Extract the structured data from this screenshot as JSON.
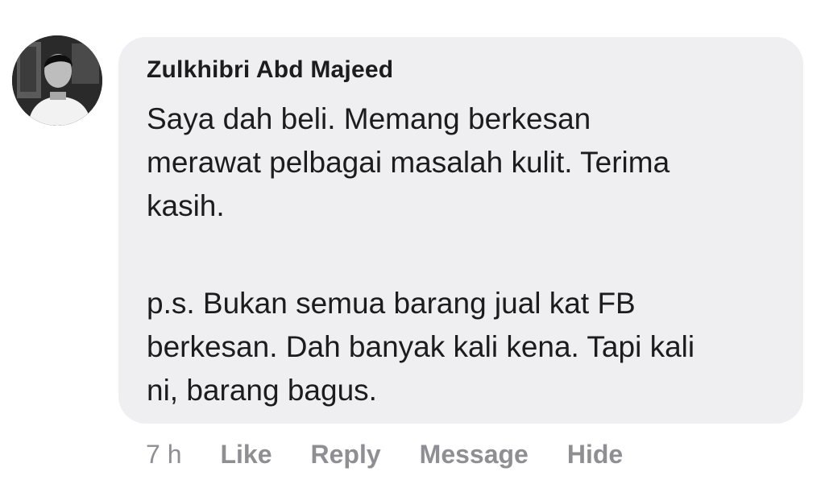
{
  "comment": {
    "author": "Zulkhibri Abd Majeed",
    "paragraph1": "Saya dah beli. Memang berkesan\nmerawat pelbagai masalah kulit. Terima\nkasih.",
    "paragraph2": "p.s. Bukan semua barang jual kat FB\nberkesan. Dah banyak kali kena. Tapi kali\nni, barang bagus.",
    "timestamp": "7 h",
    "actions": {
      "like": "Like",
      "reply": "Reply",
      "message": "Message",
      "hide": "Hide"
    }
  },
  "colors": {
    "bubble_background": "#efeff1",
    "text": "#1c1c1e",
    "action_text": "#8e8e93"
  }
}
